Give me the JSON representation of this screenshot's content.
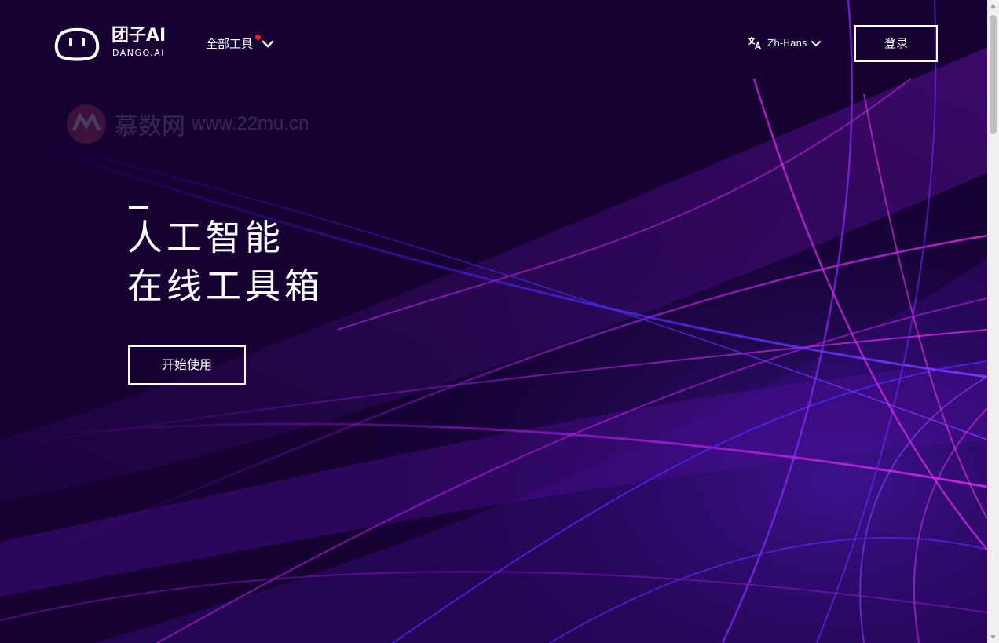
{
  "header": {
    "logo_name": "团子AI",
    "logo_sub": "DANGO.AI",
    "tools_label": "全部工具",
    "language_label": "Zh-Hans",
    "login_label": "登录"
  },
  "watermark": {
    "cn": "慕数网",
    "url": "www.22mu.cn"
  },
  "hero": {
    "line1": "人工智能",
    "line2": "在线工具箱",
    "start_label": "开始使用"
  },
  "colors": {
    "background": "#140233",
    "accent_magenta": "#d21ee6",
    "accent_blue": "#4a2bff",
    "badge_red": "#ff1a1a"
  }
}
